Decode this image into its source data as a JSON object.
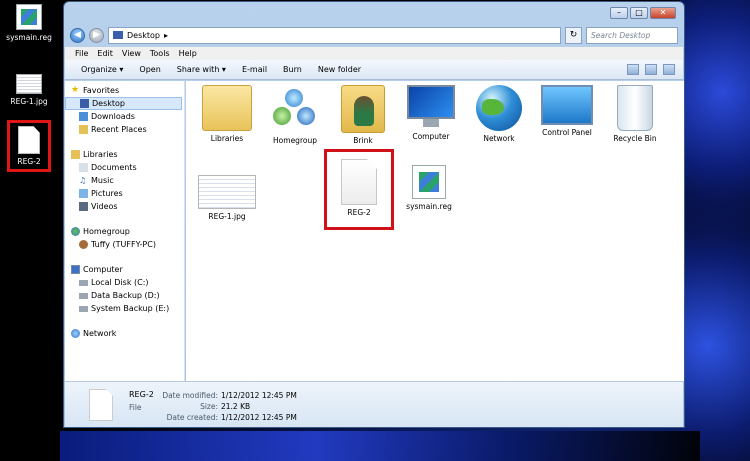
{
  "desktop": {
    "icons": [
      {
        "label": "sysmain.reg",
        "icon": "registry-file-icon"
      },
      {
        "label": "REG-1.jpg",
        "icon": "jpg-file-icon"
      },
      {
        "label": "REG-2",
        "icon": "blank-file-icon"
      }
    ]
  },
  "window": {
    "buttons": {
      "minimize": "–",
      "maximize": "□",
      "close": "✕"
    },
    "address": {
      "crumb": "Desktop",
      "arrow": "▸"
    },
    "search": {
      "placeholder": "Search Desktop"
    },
    "menu": [
      "File",
      "Edit",
      "View",
      "Tools",
      "Help"
    ],
    "toolbar": [
      {
        "label": "Organize ▾"
      },
      {
        "label": "Open"
      },
      {
        "label": "Share with ▾"
      },
      {
        "label": "E-mail"
      },
      {
        "label": "Burn"
      },
      {
        "label": "New folder"
      }
    ],
    "nav": {
      "favorites": {
        "label": "Favorites",
        "items": [
          "Desktop",
          "Downloads",
          "Recent Places"
        ]
      },
      "libraries": {
        "label": "Libraries",
        "items": [
          "Documents",
          "Music",
          "Pictures",
          "Videos"
        ]
      },
      "homegroup": {
        "label": "Homegroup",
        "items": [
          "Tuffy (TUFFY-PC)"
        ]
      },
      "computer": {
        "label": "Computer",
        "items": [
          "Local Disk (C:)",
          "Data Backup (D:)",
          "System Backup (E:)"
        ]
      },
      "network": {
        "label": "Network"
      }
    },
    "files": [
      {
        "label": "Libraries"
      },
      {
        "label": "Homegroup"
      },
      {
        "label": "Brink"
      },
      {
        "label": "Computer"
      },
      {
        "label": "Network"
      },
      {
        "label": "Control Panel"
      },
      {
        "label": "Recycle Bin"
      },
      {
        "label": "REG-1.jpg"
      },
      {
        "label": "REG-2"
      },
      {
        "label": "sysmain.reg"
      }
    ],
    "details": {
      "name": "REG-2",
      "type": "File",
      "modified_label": "Date modified:",
      "modified": "1/12/2012 12:45 PM",
      "size_label": "Size:",
      "size": "21.2 KB",
      "created_label": "Date created:",
      "created": "1/12/2012 12:45 PM"
    }
  },
  "colors": {
    "highlight": "#d0111a",
    "selection": "#d7e8fb"
  }
}
